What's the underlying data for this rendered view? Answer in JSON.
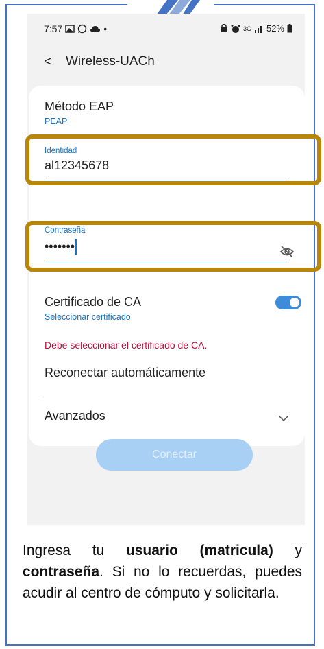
{
  "status_bar": {
    "time": "7:57",
    "left_icons": [
      "gallery-icon",
      "whatsapp-icon",
      "cloud-icon",
      "dot-icon"
    ],
    "right_icons": [
      "lock-icon",
      "alarm-icon",
      "network-icon",
      "signal-icon"
    ],
    "network_type": "3G",
    "battery": "52%"
  },
  "appbar": {
    "back_symbol": "<",
    "title": "Wireless-UACh"
  },
  "form": {
    "eap_label": "Método EAP",
    "eap_value": "PEAP",
    "identity_label": "Identidad",
    "identity_value": "al12345678",
    "password_label": "Contraseña",
    "password_value": "•••••••",
    "ca_label": "Certificado de CA",
    "ca_value": "Seleccionar certificado",
    "ca_error": "Debe seleccionar el certificado de CA.",
    "reconnect_label": "Reconectar automáticamente",
    "reconnect_on": true,
    "advanced_label": "Avanzados",
    "connect_label": "Conectar"
  },
  "caption": {
    "part1": "Ingresa tu ",
    "bold1": "usuario (matricula)",
    "part2": " y ",
    "bold2": "contraseña",
    "part3": ". Si no lo recuerdas, puedes acudir al centro de cómputo y solicitarla."
  },
  "colors": {
    "accent": "#1a73c9",
    "highlight_box": "#b8860b",
    "error": "#b3123c",
    "frame": "#4472c4",
    "toggle_on": "#3d8bd9",
    "button_disabled": "#a8d0f5"
  }
}
